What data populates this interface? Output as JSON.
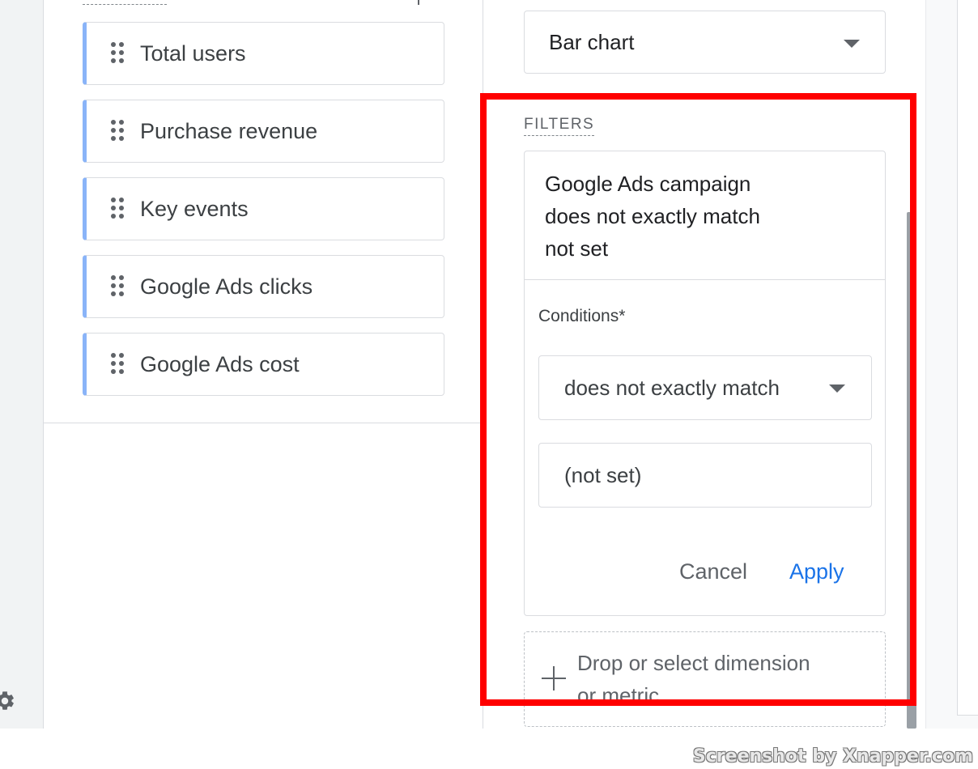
{
  "metrics": {
    "items": [
      {
        "label": "Total users"
      },
      {
        "label": "Purchase revenue"
      },
      {
        "label": "Key events"
      },
      {
        "label": "Google Ads clicks"
      },
      {
        "label": "Google Ads cost"
      }
    ],
    "accent_color": "#8ab4f8"
  },
  "visualization": {
    "selected": "Bar chart"
  },
  "filters": {
    "title": "FILTERS",
    "summary_line1": "Google Ads campaign",
    "summary_line2": "does not exactly match",
    "summary_line3": "not set",
    "conditions_label": "Conditions*",
    "condition_selected": "does not exactly match",
    "value": "(not set)",
    "cancel_label": "Cancel",
    "apply_label": "Apply",
    "apply_color": "#1a73e8"
  },
  "drop_zone": {
    "line1": "Drop or select dimension",
    "line2": "or metric"
  },
  "highlight_color": "#ff0000",
  "watermark": "Screenshot by Xnapper.com"
}
